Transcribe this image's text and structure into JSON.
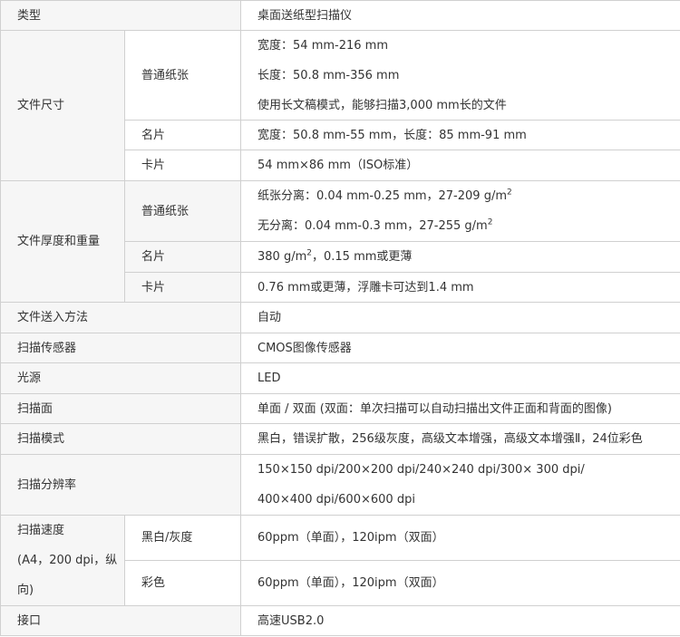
{
  "rows": {
    "type": {
      "label": "类型",
      "value": "桌面送纸型扫描仪"
    },
    "doc_size": {
      "label": "文件尺寸",
      "plain": {
        "label": "普通纸张",
        "width": "宽度：54 mm-216 mm",
        "length": "长度：50.8 mm-356 mm",
        "long_mode": "使用长文稿模式，能够扫描3,000 mm长的文件"
      },
      "card": {
        "label": "名片",
        "value": "宽度：50.8 mm-55 mm，长度：85 mm-91 mm"
      },
      "id_card": {
        "label": "卡片",
        "value": "54 mm×86 mm（ISO标准）"
      }
    },
    "thickness": {
      "label": "文件厚度和重量",
      "plain": {
        "label": "普通纸张",
        "separated_prefix": "纸张分离：0.04 mm-0.25 mm，27-209 g/m",
        "separated_sup": "2",
        "unseparated_prefix": "无分离：0.04 mm-0.3 mm，27-255 g/m",
        "unseparated_sup": "2"
      },
      "card": {
        "label": "名片",
        "value_prefix": "380 g/m",
        "value_sup": "2",
        "value_suffix": "，0.15 mm或更薄"
      },
      "id_card": {
        "label": "卡片",
        "value": "0.76 mm或更薄，浮雕卡可达到1.4 mm"
      }
    },
    "feed": {
      "label": "文件送入方法",
      "value": "自动"
    },
    "sensor": {
      "label": "扫描传感器",
      "value": "CMOS图像传感器"
    },
    "light": {
      "label": "光源",
      "value": "LED"
    },
    "side": {
      "label": "扫描面",
      "value": "单面 / 双面 (双面：单次扫描可以自动扫描出文件正面和背面的图像)"
    },
    "mode": {
      "label": "扫描模式",
      "value": "黑白，错误扩散，256级灰度，高级文本增强，高级文本增强Ⅱ，24位彩色"
    },
    "resolution": {
      "label": "扫描分辨率",
      "line1": "150×150 dpi/200×200 dpi/240×240 dpi/300× 300 dpi/",
      "line2": "400×400 dpi/600×600 dpi"
    },
    "speed": {
      "label_line1": "扫描速度",
      "label_line2": "(A4，200 dpi，纵",
      "label_line3": "向)",
      "bw": {
        "label": "黑白/灰度",
        "value": "60ppm（单面），120ipm（双面）"
      },
      "color": {
        "label": "彩色",
        "value": "60ppm（单面），120ipm（双面）"
      }
    },
    "interface": {
      "label": "接口",
      "value": "高速USB2.0"
    }
  }
}
